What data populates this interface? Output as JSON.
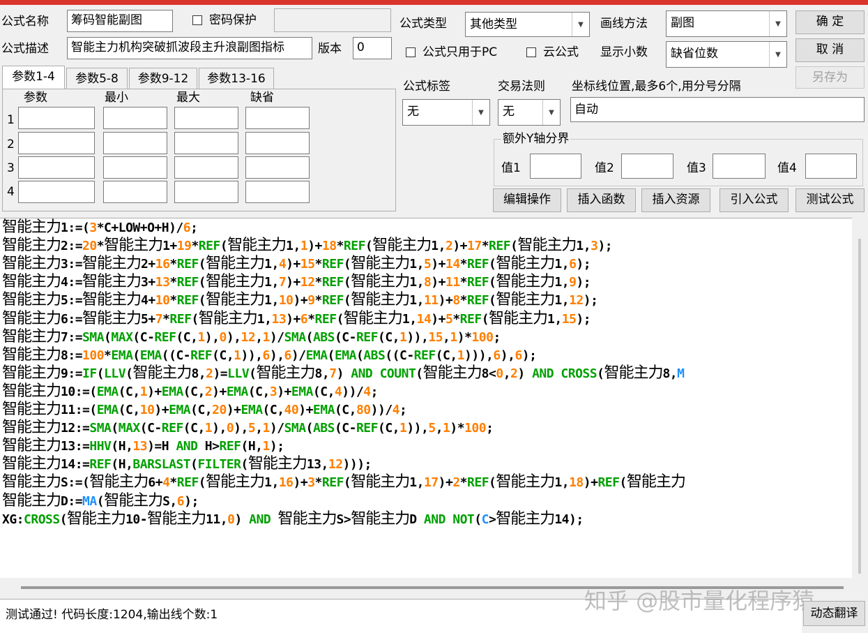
{
  "form": {
    "name_label": "公式名称",
    "name_value": "筹码智能副图",
    "password_label": "密码保护",
    "desc_label": "公式描述",
    "desc_value": "智能主力机构突破抓波段主升浪副图指标",
    "version_label": "版本",
    "version_value": "0",
    "type_label": "公式类型",
    "type_value": "其他类型",
    "draw_label": "画线方法",
    "draw_value": "副图",
    "pc_only_label": "公式只用于PC",
    "cloud_label": "云公式",
    "decimal_label": "显示小数",
    "decimal_value": "缺省位数",
    "tag_label": "公式标签",
    "tag_value": "无",
    "rule_label": "交易法则",
    "rule_value": "无",
    "coord_label": "坐标线位置,最多6个,用分号分隔",
    "coord_value": "自动",
    "yaxis_group": "额外Y轴分界",
    "y_labels": [
      "值1",
      "值2",
      "值3",
      "值4"
    ]
  },
  "buttons": {
    "ok": "确 定",
    "cancel": "取 消",
    "save_as": "另存为",
    "edit_ops": "编辑操作",
    "insert_func": "插入函数",
    "insert_res": "插入资源",
    "import": "引入公式",
    "test": "测试公式",
    "translate": "动态翻译"
  },
  "tabs": [
    "参数1-4",
    "参数5-8",
    "参数9-12",
    "参数13-16"
  ],
  "params": {
    "headers": [
      "参数",
      "最小",
      "最大",
      "缺省"
    ],
    "rows": [
      "1",
      "2",
      "3",
      "4"
    ]
  },
  "code": [
    [
      [
        "zh",
        "智能主力"
      ],
      [
        "t",
        "1:=("
      ],
      [
        "n",
        "3"
      ],
      [
        "t",
        "*C+LOW+O+H)/"
      ],
      [
        "n",
        "6"
      ],
      [
        "t",
        ";"
      ]
    ],
    [
      [
        "zh",
        "智能主力"
      ],
      [
        "t",
        "2:="
      ],
      [
        "n",
        "20"
      ],
      [
        "t",
        "*"
      ],
      [
        "zh",
        "智能主力"
      ],
      [
        "t",
        "1+"
      ],
      [
        "n",
        "19"
      ],
      [
        "t",
        "*"
      ],
      [
        "k",
        "REF"
      ],
      [
        "t",
        "("
      ],
      [
        "zh",
        "智能主力"
      ],
      [
        "t",
        "1,"
      ],
      [
        "n",
        "1"
      ],
      [
        "t",
        ")+"
      ],
      [
        "n",
        "18"
      ],
      [
        "t",
        "*"
      ],
      [
        "k",
        "REF"
      ],
      [
        "t",
        "("
      ],
      [
        "zh",
        "智能主力"
      ],
      [
        "t",
        "1,"
      ],
      [
        "n",
        "2"
      ],
      [
        "t",
        ")+"
      ],
      [
        "n",
        "17"
      ],
      [
        "t",
        "*"
      ],
      [
        "k",
        "REF"
      ],
      [
        "t",
        "("
      ],
      [
        "zh",
        "智能主力"
      ],
      [
        "t",
        "1,"
      ],
      [
        "n",
        "3"
      ],
      [
        "t",
        ");"
      ]
    ],
    [
      [
        "zh",
        "智能主力"
      ],
      [
        "t",
        "3:="
      ],
      [
        "zh",
        "智能主力"
      ],
      [
        "t",
        "2+"
      ],
      [
        "n",
        "16"
      ],
      [
        "t",
        "*"
      ],
      [
        "k",
        "REF"
      ],
      [
        "t",
        "("
      ],
      [
        "zh",
        "智能主力"
      ],
      [
        "t",
        "1,"
      ],
      [
        "n",
        "4"
      ],
      [
        "t",
        ")+"
      ],
      [
        "n",
        "15"
      ],
      [
        "t",
        "*"
      ],
      [
        "k",
        "REF"
      ],
      [
        "t",
        "("
      ],
      [
        "zh",
        "智能主力"
      ],
      [
        "t",
        "1,"
      ],
      [
        "n",
        "5"
      ],
      [
        "t",
        ")+"
      ],
      [
        "n",
        "14"
      ],
      [
        "t",
        "*"
      ],
      [
        "k",
        "REF"
      ],
      [
        "t",
        "("
      ],
      [
        "zh",
        "智能主力"
      ],
      [
        "t",
        "1,"
      ],
      [
        "n",
        "6"
      ],
      [
        "t",
        ");"
      ]
    ],
    [
      [
        "zh",
        "智能主力"
      ],
      [
        "t",
        "4:="
      ],
      [
        "zh",
        "智能主力"
      ],
      [
        "t",
        "3+"
      ],
      [
        "n",
        "13"
      ],
      [
        "t",
        "*"
      ],
      [
        "k",
        "REF"
      ],
      [
        "t",
        "("
      ],
      [
        "zh",
        "智能主力"
      ],
      [
        "t",
        "1,"
      ],
      [
        "n",
        "7"
      ],
      [
        "t",
        ")+"
      ],
      [
        "n",
        "12"
      ],
      [
        "t",
        "*"
      ],
      [
        "k",
        "REF"
      ],
      [
        "t",
        "("
      ],
      [
        "zh",
        "智能主力"
      ],
      [
        "t",
        "1,"
      ],
      [
        "n",
        "8"
      ],
      [
        "t",
        ")+"
      ],
      [
        "n",
        "11"
      ],
      [
        "t",
        "*"
      ],
      [
        "k",
        "REF"
      ],
      [
        "t",
        "("
      ],
      [
        "zh",
        "智能主力"
      ],
      [
        "t",
        "1,"
      ],
      [
        "n",
        "9"
      ],
      [
        "t",
        ");"
      ]
    ],
    [
      [
        "zh",
        "智能主力"
      ],
      [
        "t",
        "5:="
      ],
      [
        "zh",
        "智能主力"
      ],
      [
        "t",
        "4+"
      ],
      [
        "n",
        "10"
      ],
      [
        "t",
        "*"
      ],
      [
        "k",
        "REF"
      ],
      [
        "t",
        "("
      ],
      [
        "zh",
        "智能主力"
      ],
      [
        "t",
        "1,"
      ],
      [
        "n",
        "10"
      ],
      [
        "t",
        ")+"
      ],
      [
        "n",
        "9"
      ],
      [
        "t",
        "*"
      ],
      [
        "k",
        "REF"
      ],
      [
        "t",
        "("
      ],
      [
        "zh",
        "智能主力"
      ],
      [
        "t",
        "1,"
      ],
      [
        "n",
        "11"
      ],
      [
        "t",
        ")+"
      ],
      [
        "n",
        "8"
      ],
      [
        "t",
        "*"
      ],
      [
        "k",
        "REF"
      ],
      [
        "t",
        "("
      ],
      [
        "zh",
        "智能主力"
      ],
      [
        "t",
        "1,"
      ],
      [
        "n",
        "12"
      ],
      [
        "t",
        ");"
      ]
    ],
    [
      [
        "zh",
        "智能主力"
      ],
      [
        "t",
        "6:="
      ],
      [
        "zh",
        "智能主力"
      ],
      [
        "t",
        "5+"
      ],
      [
        "n",
        "7"
      ],
      [
        "t",
        "*"
      ],
      [
        "k",
        "REF"
      ],
      [
        "t",
        "("
      ],
      [
        "zh",
        "智能主力"
      ],
      [
        "t",
        "1,"
      ],
      [
        "n",
        "13"
      ],
      [
        "t",
        ")+"
      ],
      [
        "n",
        "6"
      ],
      [
        "t",
        "*"
      ],
      [
        "k",
        "REF"
      ],
      [
        "t",
        "("
      ],
      [
        "zh",
        "智能主力"
      ],
      [
        "t",
        "1,"
      ],
      [
        "n",
        "14"
      ],
      [
        "t",
        ")+"
      ],
      [
        "n",
        "5"
      ],
      [
        "t",
        "*"
      ],
      [
        "k",
        "REF"
      ],
      [
        "t",
        "("
      ],
      [
        "zh",
        "智能主力"
      ],
      [
        "t",
        "1,"
      ],
      [
        "n",
        "15"
      ],
      [
        "t",
        ");"
      ]
    ],
    [
      [
        "zh",
        "智能主力"
      ],
      [
        "t",
        "7:="
      ],
      [
        "k",
        "SMA"
      ],
      [
        "t",
        "("
      ],
      [
        "k",
        "MAX"
      ],
      [
        "t",
        "(C-"
      ],
      [
        "k",
        "REF"
      ],
      [
        "t",
        "(C,"
      ],
      [
        "n",
        "1"
      ],
      [
        "t",
        "),"
      ],
      [
        "n",
        "0"
      ],
      [
        "t",
        "),"
      ],
      [
        "n",
        "12"
      ],
      [
        "t",
        ","
      ],
      [
        "n",
        "1"
      ],
      [
        "t",
        ")/"
      ],
      [
        "k",
        "SMA"
      ],
      [
        "t",
        "("
      ],
      [
        "k",
        "ABS"
      ],
      [
        "t",
        "(C-"
      ],
      [
        "k",
        "REF"
      ],
      [
        "t",
        "(C,"
      ],
      [
        "n",
        "1"
      ],
      [
        "t",
        ")),"
      ],
      [
        "n",
        "15"
      ],
      [
        "t",
        ","
      ],
      [
        "n",
        "1"
      ],
      [
        "t",
        ")*"
      ],
      [
        "n",
        "100"
      ],
      [
        "t",
        ";"
      ]
    ],
    [
      [
        "zh",
        "智能主力"
      ],
      [
        "t",
        "8:="
      ],
      [
        "n",
        "100"
      ],
      [
        "t",
        "*"
      ],
      [
        "k",
        "EMA"
      ],
      [
        "t",
        "("
      ],
      [
        "k",
        "EMA"
      ],
      [
        "t",
        "((C-"
      ],
      [
        "k",
        "REF"
      ],
      [
        "t",
        "(C,"
      ],
      [
        "n",
        "1"
      ],
      [
        "t",
        ")),"
      ],
      [
        "n",
        "6"
      ],
      [
        "t",
        "),"
      ],
      [
        "n",
        "6"
      ],
      [
        "t",
        ")/"
      ],
      [
        "k",
        "EMA"
      ],
      [
        "t",
        "("
      ],
      [
        "k",
        "EMA"
      ],
      [
        "t",
        "("
      ],
      [
        "k",
        "ABS"
      ],
      [
        "t",
        "((C-"
      ],
      [
        "k",
        "REF"
      ],
      [
        "t",
        "(C,"
      ],
      [
        "n",
        "1"
      ],
      [
        "t",
        "))),"
      ],
      [
        "n",
        "6"
      ],
      [
        "t",
        "),"
      ],
      [
        "n",
        "6"
      ],
      [
        "t",
        ");"
      ]
    ],
    [
      [
        "zh",
        "智能主力"
      ],
      [
        "t",
        "9:="
      ],
      [
        "k",
        "IF"
      ],
      [
        "t",
        "("
      ],
      [
        "k",
        "LLV"
      ],
      [
        "t",
        "("
      ],
      [
        "zh",
        "智能主力"
      ],
      [
        "t",
        "8,"
      ],
      [
        "n",
        "2"
      ],
      [
        "t",
        ")="
      ],
      [
        "k",
        "LLV"
      ],
      [
        "t",
        "("
      ],
      [
        "zh",
        "智能主力"
      ],
      [
        "t",
        "8,"
      ],
      [
        "n",
        "7"
      ],
      [
        "t",
        ") "
      ],
      [
        "k",
        "AND COUNT"
      ],
      [
        "t",
        "("
      ],
      [
        "zh",
        "智能主力"
      ],
      [
        "t",
        "8<"
      ],
      [
        "n",
        "0"
      ],
      [
        "t",
        ","
      ],
      [
        "n",
        "2"
      ],
      [
        "t",
        ") "
      ],
      [
        "k",
        "AND CROSS"
      ],
      [
        "t",
        "("
      ],
      [
        "zh",
        "智能主力"
      ],
      [
        "t",
        "8,"
      ],
      [
        "fn",
        "M"
      ]
    ],
    [
      [
        "zh",
        "智能主力"
      ],
      [
        "t",
        "10:=("
      ],
      [
        "k",
        "EMA"
      ],
      [
        "t",
        "(C,"
      ],
      [
        "n",
        "1"
      ],
      [
        "t",
        ")+"
      ],
      [
        "k",
        "EMA"
      ],
      [
        "t",
        "(C,"
      ],
      [
        "n",
        "2"
      ],
      [
        "t",
        ")+"
      ],
      [
        "k",
        "EMA"
      ],
      [
        "t",
        "(C,"
      ],
      [
        "n",
        "3"
      ],
      [
        "t",
        ")+"
      ],
      [
        "k",
        "EMA"
      ],
      [
        "t",
        "(C,"
      ],
      [
        "n",
        "4"
      ],
      [
        "t",
        "))/"
      ],
      [
        "n",
        "4"
      ],
      [
        "t",
        ";"
      ]
    ],
    [
      [
        "zh",
        "智能主力"
      ],
      [
        "t",
        "11:=("
      ],
      [
        "k",
        "EMA"
      ],
      [
        "t",
        "(C,"
      ],
      [
        "n",
        "10"
      ],
      [
        "t",
        ")+"
      ],
      [
        "k",
        "EMA"
      ],
      [
        "t",
        "(C,"
      ],
      [
        "n",
        "20"
      ],
      [
        "t",
        ")+"
      ],
      [
        "k",
        "EMA"
      ],
      [
        "t",
        "(C,"
      ],
      [
        "n",
        "40"
      ],
      [
        "t",
        ")+"
      ],
      [
        "k",
        "EMA"
      ],
      [
        "t",
        "(C,"
      ],
      [
        "n",
        "80"
      ],
      [
        "t",
        "))/"
      ],
      [
        "n",
        "4"
      ],
      [
        "t",
        ";"
      ]
    ],
    [
      [
        "zh",
        "智能主力"
      ],
      [
        "t",
        "12:="
      ],
      [
        "k",
        "SMA"
      ],
      [
        "t",
        "("
      ],
      [
        "k",
        "MAX"
      ],
      [
        "t",
        "(C-"
      ],
      [
        "k",
        "REF"
      ],
      [
        "t",
        "(C,"
      ],
      [
        "n",
        "1"
      ],
      [
        "t",
        "),"
      ],
      [
        "n",
        "0"
      ],
      [
        "t",
        "),"
      ],
      [
        "n",
        "5"
      ],
      [
        "t",
        ","
      ],
      [
        "n",
        "1"
      ],
      [
        "t",
        ")/"
      ],
      [
        "k",
        "SMA"
      ],
      [
        "t",
        "("
      ],
      [
        "k",
        "ABS"
      ],
      [
        "t",
        "(C-"
      ],
      [
        "k",
        "REF"
      ],
      [
        "t",
        "(C,"
      ],
      [
        "n",
        "1"
      ],
      [
        "t",
        ")),"
      ],
      [
        "n",
        "5"
      ],
      [
        "t",
        ","
      ],
      [
        "n",
        "1"
      ],
      [
        "t",
        ")*"
      ],
      [
        "n",
        "100"
      ],
      [
        "t",
        ";"
      ]
    ],
    [
      [
        "zh",
        "智能主力"
      ],
      [
        "t",
        "13:="
      ],
      [
        "k",
        "HHV"
      ],
      [
        "t",
        "(H,"
      ],
      [
        "n",
        "13"
      ],
      [
        "t",
        ")=H "
      ],
      [
        "k",
        "AND"
      ],
      [
        "t",
        " H>"
      ],
      [
        "k",
        "REF"
      ],
      [
        "t",
        "(H,"
      ],
      [
        "n",
        "1"
      ],
      [
        "t",
        ");"
      ]
    ],
    [
      [
        "zh",
        "智能主力"
      ],
      [
        "t",
        "14:="
      ],
      [
        "k",
        "REF"
      ],
      [
        "t",
        "(H,"
      ],
      [
        "k",
        "BARSLAST"
      ],
      [
        "t",
        "("
      ],
      [
        "k",
        "FILTER"
      ],
      [
        "t",
        "("
      ],
      [
        "zh",
        "智能主力"
      ],
      [
        "t",
        "13,"
      ],
      [
        "n",
        "12"
      ],
      [
        "t",
        ")));"
      ]
    ],
    [
      [
        "zh",
        "智能主力"
      ],
      [
        "t",
        "S:=("
      ],
      [
        "zh",
        "智能主力"
      ],
      [
        "t",
        "6+"
      ],
      [
        "n",
        "4"
      ],
      [
        "t",
        "*"
      ],
      [
        "k",
        "REF"
      ],
      [
        "t",
        "("
      ],
      [
        "zh",
        "智能主力"
      ],
      [
        "t",
        "1,"
      ],
      [
        "n",
        "16"
      ],
      [
        "t",
        ")+"
      ],
      [
        "n",
        "3"
      ],
      [
        "t",
        "*"
      ],
      [
        "k",
        "REF"
      ],
      [
        "t",
        "("
      ],
      [
        "zh",
        "智能主力"
      ],
      [
        "t",
        "1,"
      ],
      [
        "n",
        "17"
      ],
      [
        "t",
        ")+"
      ],
      [
        "n",
        "2"
      ],
      [
        "t",
        "*"
      ],
      [
        "k",
        "REF"
      ],
      [
        "t",
        "("
      ],
      [
        "zh",
        "智能主力"
      ],
      [
        "t",
        "1,"
      ],
      [
        "n",
        "18"
      ],
      [
        "t",
        ")+"
      ],
      [
        "k",
        "REF"
      ],
      [
        "t",
        "("
      ],
      [
        "zh",
        "智能主力"
      ]
    ],
    [
      [
        "zh",
        "智能主力"
      ],
      [
        "t",
        "D:="
      ],
      [
        "fn",
        "MA"
      ],
      [
        "t",
        "("
      ],
      [
        "zh",
        "智能主力"
      ],
      [
        "t",
        "S,"
      ],
      [
        "n",
        "6"
      ],
      [
        "t",
        ");"
      ]
    ],
    [
      [
        "t",
        "XG:"
      ],
      [
        "k",
        "CROSS"
      ],
      [
        "t",
        "("
      ],
      [
        "zh",
        "智能主力"
      ],
      [
        "t",
        "10-"
      ],
      [
        "zh",
        "智能主力"
      ],
      [
        "t",
        "11,"
      ],
      [
        "n",
        "0"
      ],
      [
        "t",
        ") "
      ],
      [
        "k",
        "AND"
      ],
      [
        "t",
        " "
      ],
      [
        "zh",
        "智能主力"
      ],
      [
        "t",
        "S>"
      ],
      [
        "zh",
        "智能主力"
      ],
      [
        "t",
        "D "
      ],
      [
        "k",
        "AND NOT"
      ],
      [
        "t",
        "("
      ],
      [
        "fn",
        "C"
      ],
      [
        "t",
        ">"
      ],
      [
        "zh",
        "智能主力"
      ],
      [
        "t",
        "14);"
      ]
    ]
  ],
  "status": "测试通过! 代码长度:1204,输出线个数:1",
  "watermark": "知乎 @股市量化程序猿"
}
